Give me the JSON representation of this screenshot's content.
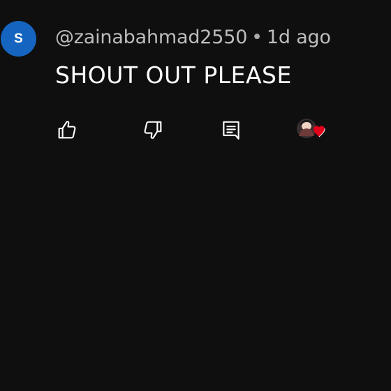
{
  "comment": {
    "avatar_letter": "S",
    "username": "@zainabahmad2550",
    "separator": "•",
    "time": "1d ago",
    "text": "SHOUT OUT PLEASE"
  },
  "actions": {
    "like_icon": "thumbs-up-icon",
    "dislike_icon": "thumbs-down-icon",
    "reply_icon": "reply-comment-icon",
    "creator_heart_icon": "creator-heart-icon"
  },
  "colors": {
    "background": "#0f0f0f",
    "avatar": "#1565c0",
    "text": "#ffffff",
    "meta_text": "#bdbdbd",
    "heart": "#e3001b"
  }
}
